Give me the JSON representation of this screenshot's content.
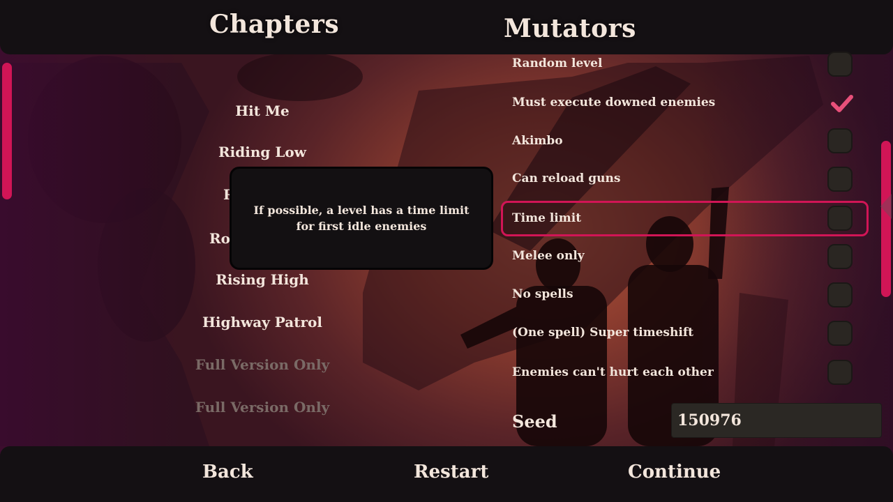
{
  "headers": {
    "chapters": "Chapters",
    "mutators": "Mutators"
  },
  "chapters": [
    {
      "label": "Hit Me",
      "locked": false
    },
    {
      "label": "Riding Low",
      "locked": false
    },
    {
      "label": "R",
      "locked": false
    },
    {
      "label": "Ro",
      "locked": false
    },
    {
      "label": "Rising High",
      "locked": false
    },
    {
      "label": "Highway Patrol",
      "locked": false
    },
    {
      "label": "Full Version Only",
      "locked": true
    },
    {
      "label": "Full Version Only",
      "locked": true
    }
  ],
  "tooltip": {
    "text": "If possible, a level has a time limit for first idle enemies"
  },
  "mutators": [
    {
      "label": "Random level",
      "checked": false
    },
    {
      "label": "Must execute downed enemies",
      "checked": true
    },
    {
      "label": "Akimbo",
      "checked": false
    },
    {
      "label": "Can reload guns",
      "checked": false
    },
    {
      "label": "Time limit",
      "checked": false,
      "selected": true
    },
    {
      "label": "Melee only",
      "checked": false
    },
    {
      "label": "No spells",
      "checked": false
    },
    {
      "label": "(One spell) Super timeshift",
      "checked": false
    },
    {
      "label": "Enemies can't hurt each other",
      "checked": false
    }
  ],
  "seed": {
    "label": "Seed",
    "value": "150976"
  },
  "footer": {
    "back": "Back",
    "restart": "Restart",
    "continue": "Continue"
  },
  "colors": {
    "accent": "#d11556",
    "text": "#f3e6dc",
    "panel": "#141013",
    "locked_text": "#7a6a66"
  }
}
